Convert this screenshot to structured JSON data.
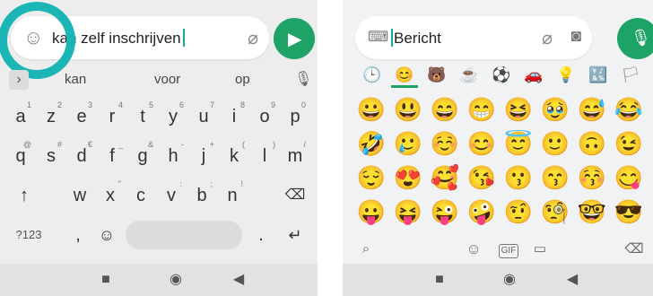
{
  "left": {
    "composer_text": "kan zelf inschrijven",
    "suggestions": [
      "kan",
      "voor",
      "op"
    ],
    "row1": [
      [
        "a",
        "1"
      ],
      [
        "z",
        "2"
      ],
      [
        "e",
        "3"
      ],
      [
        "r",
        "4"
      ],
      [
        "t",
        "5"
      ],
      [
        "y",
        "6"
      ],
      [
        "u",
        "7"
      ],
      [
        "i",
        "8"
      ],
      [
        "o",
        "9"
      ],
      [
        "p",
        "0"
      ]
    ],
    "row2": [
      [
        "q",
        "@"
      ],
      [
        "s",
        "#"
      ],
      [
        "d",
        "€"
      ],
      [
        "f",
        "_"
      ],
      [
        "g",
        "&"
      ],
      [
        "h",
        "-"
      ],
      [
        "j",
        "+"
      ],
      [
        "k",
        "("
      ],
      [
        "l",
        ")"
      ],
      [
        "m",
        "/"
      ]
    ],
    "row3": [
      [
        "w",
        ""
      ],
      [
        "x",
        "\""
      ],
      [
        "c",
        ""
      ],
      [
        "v",
        ":"
      ],
      [
        "b",
        ";"
      ],
      [
        "n",
        "!"
      ]
    ],
    "bottom_row": {
      "numbers": "?123",
      "comma": ",",
      "period": ".",
      "apostrophe": "'"
    },
    "keys": {
      "shift": "↑",
      "backspace": "⌫",
      "enter": "↵",
      "emoji": "☺",
      "mic": "🎙",
      "expand": "›"
    }
  },
  "right": {
    "composer_text": "Bericht",
    "categories": [
      "🕒",
      "😊",
      "🐻",
      "☕",
      "⚽",
      "🚗",
      "💡",
      "🔣",
      "🏳"
    ],
    "emojis": [
      [
        "😀",
        "😃",
        "😄",
        "😁",
        "😆",
        "🥹",
        "😅",
        "😂"
      ],
      [
        "🤣",
        "🥲",
        "☺️",
        "😊",
        "😇",
        "🙂",
        "🙃",
        "😉"
      ],
      [
        "😌",
        "😍",
        "🥰",
        "😘",
        "😗",
        "😙",
        "😚",
        "😋"
      ],
      [
        "😛",
        "😝",
        "😜",
        "🤪",
        "🤨",
        "🧐",
        "🤓",
        "😎"
      ]
    ],
    "tools": {
      "search": "⌕",
      "emoji": "☺",
      "gif": "GIF",
      "sticker": "▭",
      "backspace": "⌫"
    }
  },
  "nav": {
    "recent": "■",
    "home": "◉",
    "back": "◀"
  }
}
